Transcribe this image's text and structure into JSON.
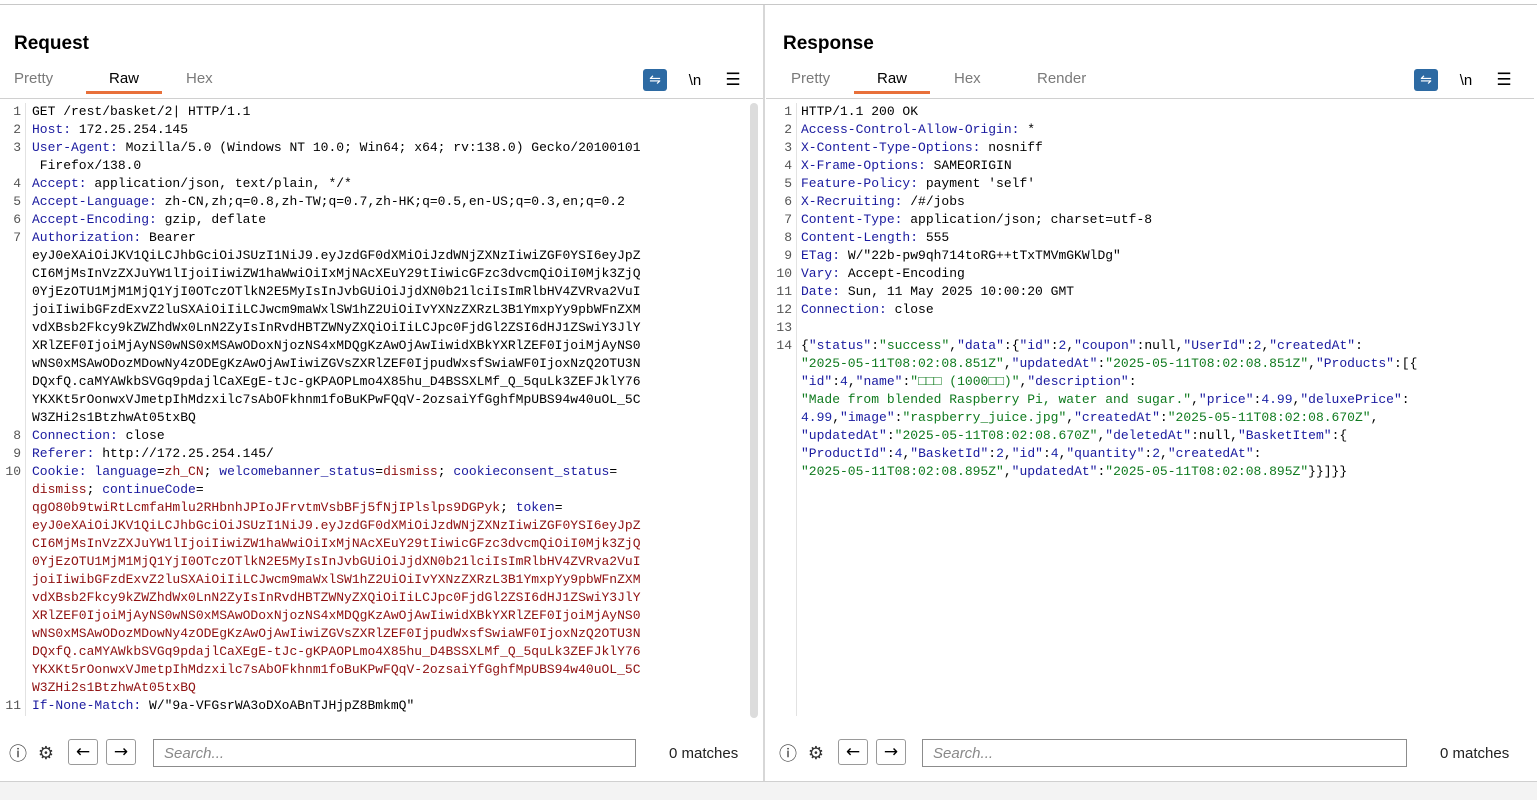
{
  "request": {
    "title": "Request",
    "tabs": [
      {
        "label": "Pretty",
        "active": false
      },
      {
        "label": "Raw",
        "active": true
      },
      {
        "label": "Hex",
        "active": false
      }
    ],
    "newline_label": "\\n",
    "search": {
      "placeholder": "Search...",
      "matches": "0 matches"
    },
    "lines": [
      {
        "n": "1",
        "seg": [
          {
            "t": "GET /rest/basket/2",
            "c": "v"
          },
          {
            "t": "|",
            "c": "v"
          },
          {
            "t": " HTTP/1.1",
            "c": "v"
          }
        ],
        "hl": true
      },
      {
        "n": "2",
        "seg": [
          {
            "t": "Host:",
            "c": "k"
          },
          {
            "t": " 172.25.254.145",
            "c": "v"
          }
        ]
      },
      {
        "n": "3",
        "seg": [
          {
            "t": "User-Agent:",
            "c": "k"
          },
          {
            "t": " Mozilla/5.0 (Windows NT 10.0; Win64; x64; rv:138.0) Gecko/20100101",
            "c": "v"
          }
        ]
      },
      {
        "n": "",
        "seg": [
          {
            "t": " Firefox/138.0",
            "c": "v"
          }
        ]
      },
      {
        "n": "4",
        "seg": [
          {
            "t": "Accept:",
            "c": "k"
          },
          {
            "t": " application/json, text/plain, */*",
            "c": "v"
          }
        ]
      },
      {
        "n": "5",
        "seg": [
          {
            "t": "Accept-Language:",
            "c": "k"
          },
          {
            "t": " zh-CN,zh;q=0.8,zh-TW;q=0.7,zh-HK;q=0.5,en-US;q=0.3,en;q=0.2",
            "c": "v"
          }
        ]
      },
      {
        "n": "6",
        "seg": [
          {
            "t": "Accept-Encoding:",
            "c": "k"
          },
          {
            "t": " gzip, deflate",
            "c": "v"
          }
        ]
      },
      {
        "n": "7",
        "seg": [
          {
            "t": "Authorization:",
            "c": "k"
          },
          {
            "t": " Bearer",
            "c": "v"
          }
        ]
      },
      {
        "n": "",
        "seg": [
          {
            "t": "eyJ0eXAiOiJKV1QiLCJhbGciOiJSUzI1NiJ9.eyJzdGF0dXMiOiJzdWNjZXNzIiwiZGF0YSI6eyJpZ",
            "c": "v"
          }
        ]
      },
      {
        "n": "",
        "seg": [
          {
            "t": "CI6MjMsInVzZXJuYW1lIjoiIiwiZW1haWwiOiIxMjNAcXEuY29tIiwicGFzc3dvcmQiOiI0Mjk3ZjQ",
            "c": "v"
          }
        ]
      },
      {
        "n": "",
        "seg": [
          {
            "t": "0YjEzOTU1MjM1MjQ1YjI0OTczOTlkN2E5MyIsInJvbGUiOiJjdXN0b21lciIsImRlbHV4ZVRva2VuI",
            "c": "v"
          }
        ]
      },
      {
        "n": "",
        "seg": [
          {
            "t": "joiIiwibGFzdExvZ2luSXAiOiIiLCJwcm9maWxlSW1hZ2UiOiIvYXNzZXRzL3B1YmxpYy9pbWFnZXM",
            "c": "v"
          }
        ]
      },
      {
        "n": "",
        "seg": [
          {
            "t": "vdXBsb2Fkcy9kZWZhdWx0LnN2ZyIsInRvdHBTZWNyZXQiOiIiLCJpc0FjdGl2ZSI6dHJ1ZSwiY3JlY",
            "c": "v"
          }
        ]
      },
      {
        "n": "",
        "seg": [
          {
            "t": "XRlZEF0IjoiMjAyNS0wNS0xMSAwODoxNjozNS4xMDQgKzAwOjAwIiwidXBkYXRlZEF0IjoiMjAyNS0",
            "c": "v"
          }
        ]
      },
      {
        "n": "",
        "seg": [
          {
            "t": "wNS0xMSAwODozMDowNy4zODEgKzAwOjAwIiwiZGVsZXRlZEF0IjpudWxsfSwiaWF0IjoxNzQ2OTU3N",
            "c": "v"
          }
        ]
      },
      {
        "n": "",
        "seg": [
          {
            "t": "DQxfQ.caMYAWkbSVGq9pdajlCaXEgE-tJc-gKPAOPLmo4X85hu_D4BSSXLMf_Q_5quLk3ZEFJklY76",
            "c": "v"
          }
        ]
      },
      {
        "n": "",
        "seg": [
          {
            "t": "YKXKt5rOonwxVJmetpIhMdzxilc7sAbOFkhnm1foBuKPwFQqV-2ozsaiYfGghfMpUBS94w40uOL_5C",
            "c": "v"
          }
        ]
      },
      {
        "n": "",
        "seg": [
          {
            "t": "W3ZHi2s1BtzhwAt05txBQ",
            "c": "v"
          }
        ]
      },
      {
        "n": "8",
        "seg": [
          {
            "t": "Connection:",
            "c": "k"
          },
          {
            "t": " close",
            "c": "v"
          }
        ]
      },
      {
        "n": "9",
        "seg": [
          {
            "t": "Referer:",
            "c": "k"
          },
          {
            "t": " http://172.25.254.145/",
            "c": "v"
          }
        ]
      },
      {
        "n": "10",
        "seg": [
          {
            "t": "Cookie:",
            "c": "k"
          },
          {
            "t": " language",
            "c": "k"
          },
          {
            "t": "=",
            "c": "v"
          },
          {
            "t": "zh_CN",
            "c": "r"
          },
          {
            "t": ";",
            "c": "v"
          },
          {
            "t": " welcomebanner_status",
            "c": "k"
          },
          {
            "t": "=",
            "c": "v"
          },
          {
            "t": "dismiss",
            "c": "r"
          },
          {
            "t": ";",
            "c": "v"
          },
          {
            "t": " cookieconsent_status",
            "c": "k"
          },
          {
            "t": "=",
            "c": "v"
          }
        ]
      },
      {
        "n": "",
        "seg": [
          {
            "t": "dismiss",
            "c": "r"
          },
          {
            "t": ";",
            "c": "v"
          },
          {
            "t": " continueCode",
            "c": "k"
          },
          {
            "t": "=",
            "c": "v"
          }
        ]
      },
      {
        "n": "",
        "seg": [
          {
            "t": "qgO80b9twiRtLcmfaHmlu2RHbnhJPIoJFrvtmVsbBFj5fNjIPlslps9DGPyk",
            "c": "r"
          },
          {
            "t": ";",
            "c": "v"
          },
          {
            "t": " token",
            "c": "k"
          },
          {
            "t": "=",
            "c": "v"
          }
        ]
      },
      {
        "n": "",
        "seg": [
          {
            "t": "eyJ0eXAiOiJKV1QiLCJhbGciOiJSUzI1NiJ9.eyJzdGF0dXMiOiJzdWNjZXNzIiwiZGF0YSI6eyJpZ",
            "c": "r"
          }
        ]
      },
      {
        "n": "",
        "seg": [
          {
            "t": "CI6MjMsInVzZXJuYW1lIjoiIiwiZW1haWwiOiIxMjNAcXEuY29tIiwicGFzc3dvcmQiOiI0Mjk3ZjQ",
            "c": "r"
          }
        ]
      },
      {
        "n": "",
        "seg": [
          {
            "t": "0YjEzOTU1MjM1MjQ1YjI0OTczOTlkN2E5MyIsInJvbGUiOiJjdXN0b21lciIsImRlbHV4ZVRva2VuI",
            "c": "r"
          }
        ]
      },
      {
        "n": "",
        "seg": [
          {
            "t": "joiIiwibGFzdExvZ2luSXAiOiIiLCJwcm9maWxlSW1hZ2UiOiIvYXNzZXRzL3B1YmxpYy9pbWFnZXM",
            "c": "r"
          }
        ]
      },
      {
        "n": "",
        "seg": [
          {
            "t": "vdXBsb2Fkcy9kZWZhdWx0LnN2ZyIsInRvdHBTZWNyZXQiOiIiLCJpc0FjdGl2ZSI6dHJ1ZSwiY3JlY",
            "c": "r"
          }
        ]
      },
      {
        "n": "",
        "seg": [
          {
            "t": "XRlZEF0IjoiMjAyNS0wNS0xMSAwODoxNjozNS4xMDQgKzAwOjAwIiwidXBkYXRlZEF0IjoiMjAyNS0",
            "c": "r"
          }
        ]
      },
      {
        "n": "",
        "seg": [
          {
            "t": "wNS0xMSAwODozMDowNy4zODEgKzAwOjAwIiwiZGVsZXRlZEF0IjpudWxsfSwiaWF0IjoxNzQ2OTU3N",
            "c": "r"
          }
        ]
      },
      {
        "n": "",
        "seg": [
          {
            "t": "DQxfQ.caMYAWkbSVGq9pdajlCaXEgE-tJc-gKPAOPLmo4X85hu_D4BSSXLMf_Q_5quLk3ZEFJklY76",
            "c": "r"
          }
        ]
      },
      {
        "n": "",
        "seg": [
          {
            "t": "YKXKt5rOonwxVJmetpIhMdzxilc7sAbOFkhnm1foBuKPwFQqV-2ozsaiYfGghfMpUBS94w40uOL_5C",
            "c": "r"
          }
        ]
      },
      {
        "n": "",
        "seg": [
          {
            "t": "W3ZHi2s1BtzhwAt05txBQ",
            "c": "r"
          }
        ]
      },
      {
        "n": "11",
        "seg": [
          {
            "t": "If-None-Match:",
            "c": "k"
          },
          {
            "t": " W/\"9a-VFGsrWA3oDXoABnTJHjpZ8BmkmQ\"",
            "c": "v"
          }
        ]
      },
      {
        "n": "12",
        "seg": [
          {
            "t": "",
            "c": "v"
          }
        ]
      }
    ]
  },
  "response": {
    "title": "Response",
    "tabs": [
      {
        "label": "Pretty",
        "active": false
      },
      {
        "label": "Raw",
        "active": true
      },
      {
        "label": "Hex",
        "active": false
      },
      {
        "label": "Render",
        "active": false
      }
    ],
    "newline_label": "\\n",
    "search": {
      "placeholder": "Search...",
      "matches": "0 matches"
    },
    "lines": [
      {
        "n": "1",
        "seg": [
          {
            "t": "HTTP/1.1 200 OK",
            "c": "v"
          }
        ],
        "hl": true
      },
      {
        "n": "2",
        "seg": [
          {
            "t": "Access-Control-Allow-Origin:",
            "c": "k"
          },
          {
            "t": " *",
            "c": "v"
          }
        ]
      },
      {
        "n": "3",
        "seg": [
          {
            "t": "X-Content-Type-Options:",
            "c": "k"
          },
          {
            "t": " nosniff",
            "c": "v"
          }
        ]
      },
      {
        "n": "4",
        "seg": [
          {
            "t": "X-Frame-Options:",
            "c": "k"
          },
          {
            "t": " SAMEORIGIN",
            "c": "v"
          }
        ]
      },
      {
        "n": "5",
        "seg": [
          {
            "t": "Feature-Policy:",
            "c": "k"
          },
          {
            "t": " payment 'self'",
            "c": "v"
          }
        ]
      },
      {
        "n": "6",
        "seg": [
          {
            "t": "X-Recruiting:",
            "c": "k"
          },
          {
            "t": " /#/jobs",
            "c": "v"
          }
        ]
      },
      {
        "n": "7",
        "seg": [
          {
            "t": "Content-Type:",
            "c": "k"
          },
          {
            "t": " application/json; charset=utf-8",
            "c": "v"
          }
        ]
      },
      {
        "n": "8",
        "seg": [
          {
            "t": "Content-Length:",
            "c": "k"
          },
          {
            "t": " 555",
            "c": "v"
          }
        ]
      },
      {
        "n": "9",
        "seg": [
          {
            "t": "ETag:",
            "c": "k"
          },
          {
            "t": " W/\"22b-pw9qh714toRG++tTxTMVmGKWlDg\"",
            "c": "v"
          }
        ]
      },
      {
        "n": "10",
        "seg": [
          {
            "t": "Vary:",
            "c": "k"
          },
          {
            "t": " Accept-Encoding",
            "c": "v"
          }
        ]
      },
      {
        "n": "11",
        "seg": [
          {
            "t": "Date:",
            "c": "k"
          },
          {
            "t": " Sun, 11 May 2025 10:00:20 GMT",
            "c": "v"
          }
        ]
      },
      {
        "n": "12",
        "seg": [
          {
            "t": "Connection:",
            "c": "k"
          },
          {
            "t": " close",
            "c": "v"
          }
        ]
      },
      {
        "n": "13",
        "seg": [
          {
            "t": "",
            "c": "v"
          }
        ]
      },
      {
        "n": "14",
        "seg": [
          {
            "t": "{",
            "c": "v"
          },
          {
            "t": "\"status\"",
            "c": "k"
          },
          {
            "t": ":",
            "c": "v"
          },
          {
            "t": "\"success\"",
            "c": "s"
          },
          {
            "t": ",",
            "c": "v"
          },
          {
            "t": "\"data\"",
            "c": "k"
          },
          {
            "t": ":{",
            "c": "v"
          },
          {
            "t": "\"id\"",
            "c": "k"
          },
          {
            "t": ":",
            "c": "v"
          },
          {
            "t": "2",
            "c": "n"
          },
          {
            "t": ",",
            "c": "v"
          },
          {
            "t": "\"coupon\"",
            "c": "k"
          },
          {
            "t": ":null,",
            "c": "v"
          },
          {
            "t": "\"UserId\"",
            "c": "k"
          },
          {
            "t": ":",
            "c": "v"
          },
          {
            "t": "2",
            "c": "n"
          },
          {
            "t": ",",
            "c": "v"
          },
          {
            "t": "\"createdAt\"",
            "c": "k"
          },
          {
            "t": ":",
            "c": "v"
          }
        ]
      },
      {
        "n": "",
        "seg": [
          {
            "t": "\"2025-05-11T08:02:08.851Z\"",
            "c": "s"
          },
          {
            "t": ",",
            "c": "v"
          },
          {
            "t": "\"updatedAt\"",
            "c": "k"
          },
          {
            "t": ":",
            "c": "v"
          },
          {
            "t": "\"2025-05-11T08:02:08.851Z\"",
            "c": "s"
          },
          {
            "t": ",",
            "c": "v"
          },
          {
            "t": "\"Products\"",
            "c": "k"
          },
          {
            "t": ":[{",
            "c": "v"
          }
        ]
      },
      {
        "n": "",
        "seg": [
          {
            "t": "\"id\"",
            "c": "k"
          },
          {
            "t": ":",
            "c": "v"
          },
          {
            "t": "4",
            "c": "n"
          },
          {
            "t": ",",
            "c": "v"
          },
          {
            "t": "\"name\"",
            "c": "k"
          },
          {
            "t": ":",
            "c": "v"
          },
          {
            "t": "\"□□□ (1000□□)\"",
            "c": "s"
          },
          {
            "t": ",",
            "c": "v"
          },
          {
            "t": "\"description\"",
            "c": "k"
          },
          {
            "t": ":",
            "c": "v"
          }
        ]
      },
      {
        "n": "",
        "seg": [
          {
            "t": "\"Made from blended Raspberry Pi, water and sugar.\"",
            "c": "s"
          },
          {
            "t": ",",
            "c": "v"
          },
          {
            "t": "\"price\"",
            "c": "k"
          },
          {
            "t": ":",
            "c": "v"
          },
          {
            "t": "4.99",
            "c": "n"
          },
          {
            "t": ",",
            "c": "v"
          },
          {
            "t": "\"deluxePrice\"",
            "c": "k"
          },
          {
            "t": ":",
            "c": "v"
          }
        ]
      },
      {
        "n": "",
        "seg": [
          {
            "t": "4.99",
            "c": "n"
          },
          {
            "t": ",",
            "c": "v"
          },
          {
            "t": "\"image\"",
            "c": "k"
          },
          {
            "t": ":",
            "c": "v"
          },
          {
            "t": "\"raspberry_juice.jpg\"",
            "c": "s"
          },
          {
            "t": ",",
            "c": "v"
          },
          {
            "t": "\"createdAt\"",
            "c": "k"
          },
          {
            "t": ":",
            "c": "v"
          },
          {
            "t": "\"2025-05-11T08:02:08.670Z\"",
            "c": "s"
          },
          {
            "t": ",",
            "c": "v"
          }
        ]
      },
      {
        "n": "",
        "seg": [
          {
            "t": "\"updatedAt\"",
            "c": "k"
          },
          {
            "t": ":",
            "c": "v"
          },
          {
            "t": "\"2025-05-11T08:02:08.670Z\"",
            "c": "s"
          },
          {
            "t": ",",
            "c": "v"
          },
          {
            "t": "\"deletedAt\"",
            "c": "k"
          },
          {
            "t": ":null,",
            "c": "v"
          },
          {
            "t": "\"BasketItem\"",
            "c": "k"
          },
          {
            "t": ":{",
            "c": "v"
          }
        ]
      },
      {
        "n": "",
        "seg": [
          {
            "t": "\"ProductId\"",
            "c": "k"
          },
          {
            "t": ":",
            "c": "v"
          },
          {
            "t": "4",
            "c": "n"
          },
          {
            "t": ",",
            "c": "v"
          },
          {
            "t": "\"BasketId\"",
            "c": "k"
          },
          {
            "t": ":",
            "c": "v"
          },
          {
            "t": "2",
            "c": "n"
          },
          {
            "t": ",",
            "c": "v"
          },
          {
            "t": "\"id\"",
            "c": "k"
          },
          {
            "t": ":",
            "c": "v"
          },
          {
            "t": "4",
            "c": "n"
          },
          {
            "t": ",",
            "c": "v"
          },
          {
            "t": "\"quantity\"",
            "c": "k"
          },
          {
            "t": ":",
            "c": "v"
          },
          {
            "t": "2",
            "c": "n"
          },
          {
            "t": ",",
            "c": "v"
          },
          {
            "t": "\"createdAt\"",
            "c": "k"
          },
          {
            "t": ":",
            "c": "v"
          }
        ]
      },
      {
        "n": "",
        "seg": [
          {
            "t": "\"2025-05-11T08:02:08.895Z\"",
            "c": "s"
          },
          {
            "t": ",",
            "c": "v"
          },
          {
            "t": "\"updatedAt\"",
            "c": "k"
          },
          {
            "t": ":",
            "c": "v"
          },
          {
            "t": "\"2025-05-11T08:02:08.895Z\"",
            "c": "s"
          },
          {
            "t": "}}]}}",
            "c": "v"
          }
        ]
      }
    ]
  }
}
